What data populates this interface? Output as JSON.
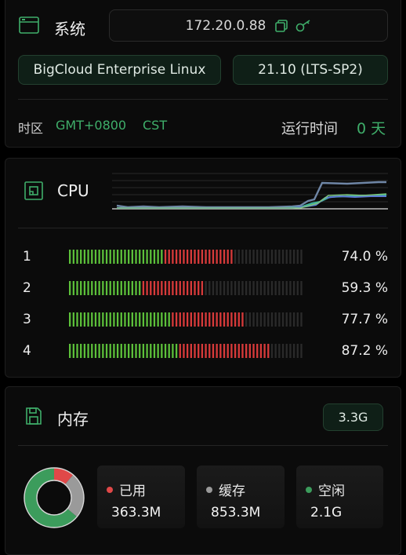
{
  "system": {
    "title": "系统",
    "ip": "172.20.0.88",
    "os_name": "BigCloud Enterprise Linux",
    "os_version": "21.10 (LTS-SP2)",
    "timezone_label": "时区",
    "timezone_value": "GMT+0800",
    "timezone_name": "CST",
    "uptime_label": "运行时间",
    "uptime_value": "0 天"
  },
  "cpu": {
    "title": "CPU",
    "cores": [
      {
        "id": "1",
        "percent_label": "74.0 %",
        "green": 0.406,
        "red": 0.297
      },
      {
        "id": "2",
        "percent_label": "59.3 %",
        "green": 0.313,
        "red": 0.266
      },
      {
        "id": "3",
        "percent_label": "77.7 %",
        "green": 0.438,
        "red": 0.313
      },
      {
        "id": "4",
        "percent_label": "87.2 %",
        "green": 0.469,
        "red": 0.391
      }
    ]
  },
  "memory": {
    "title": "内存",
    "total": "3.3G",
    "used_label": "已用",
    "used_value": "363.3M",
    "cache_label": "缓存",
    "cache_value": "853.3M",
    "free_label": "空闲",
    "free_value": "2.1G",
    "donut": {
      "used": 0.11,
      "cache": 0.25,
      "free": 0.64
    }
  },
  "colors": {
    "accent": "#3fae6a",
    "bar_green": "#5cc03a",
    "bar_red": "#d83a3a",
    "bar_idle": "#2a2a2a",
    "used": "#e04848",
    "cache": "#9a9a9a",
    "free": "#3c9c5c"
  },
  "icons": {
    "system": "window-icon",
    "copy": "copy-icon",
    "key": "key-icon",
    "cpu": "chip-icon",
    "memory": "floppy-icon"
  }
}
